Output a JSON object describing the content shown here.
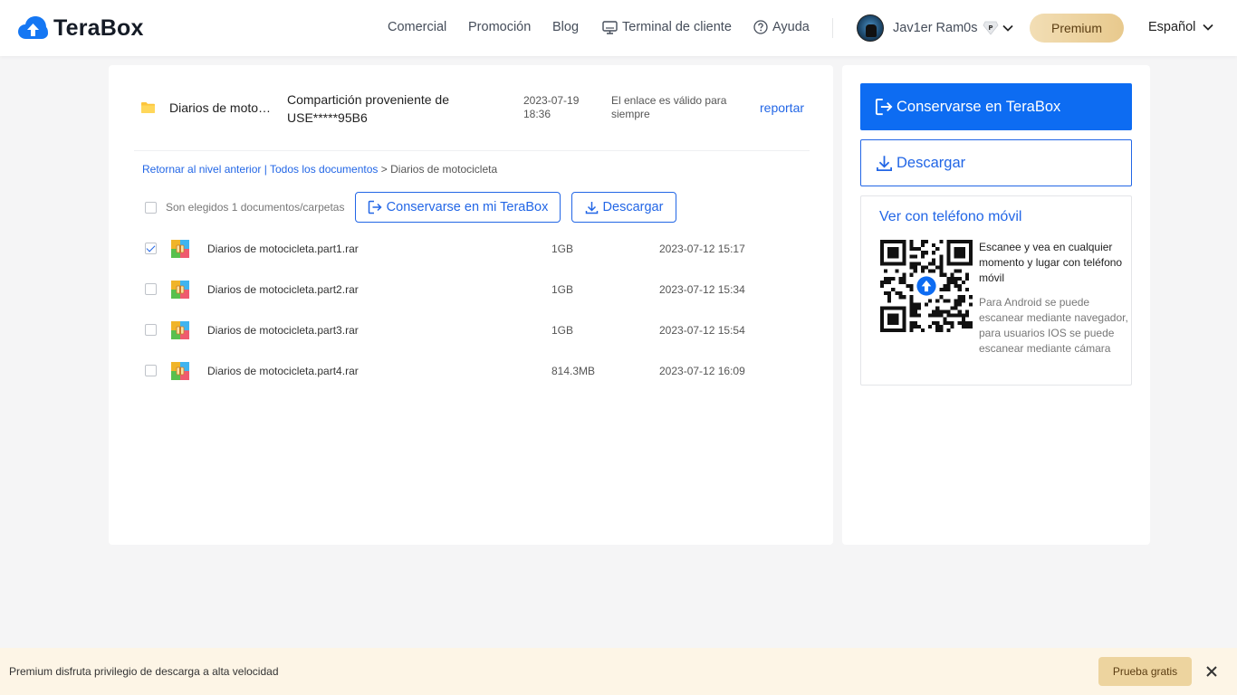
{
  "header": {
    "brand": "TeraBox",
    "nav": [
      "Comercial",
      "Promoción",
      "Blog",
      "Terminal de cliente",
      "Ayuda"
    ],
    "user_name": "Jav1er Ram0s",
    "premium_label": "Premium",
    "language": "Español"
  },
  "share": {
    "folder_name": "Diarios de motocicleta",
    "from_label": "Compartición proveniente de USE*****95B6",
    "date": "2023-07-19 18:36",
    "validity": "El enlace es válido para siempre",
    "report_label": "reportar"
  },
  "breadcrumb": {
    "back": "Retornar al nivel anterior",
    "sep": "|",
    "all": "Todos los documentos",
    "arrow": ">",
    "current": "Diarios de motocicleta"
  },
  "toolbar": {
    "selected_text": "Son elegidos 1 documentos/carpetas",
    "save_label": "Conservarse en mi TeraBox",
    "download_label": "Descargar"
  },
  "files": [
    {
      "name": "Diarios de motocicleta.part1.rar",
      "size": "1GB",
      "date": "2023-07-12 15:17",
      "checked": true
    },
    {
      "name": "Diarios de motocicleta.part2.rar",
      "size": "1GB",
      "date": "2023-07-12 15:34",
      "checked": false
    },
    {
      "name": "Diarios de motocicleta.part3.rar",
      "size": "1GB",
      "date": "2023-07-12 15:54",
      "checked": false
    },
    {
      "name": "Diarios de motocicleta.part4.rar",
      "size": "814.3MB",
      "date": "2023-07-12 16:09",
      "checked": false
    }
  ],
  "side": {
    "save_label": "Conservarse en TeraBox",
    "download_label": "Descargar",
    "mobile_title": "Ver con teléfono móvil",
    "scan_text": "Escanee y vea en cualquier momento y lugar con teléfono móvil",
    "android_text": "Para Android se puede escanear mediante navegador, para usuarios IOS se puede escanear mediante cámara"
  },
  "bottom": {
    "promo_text": "Premium disfruta privilegio de descarga a alta velocidad",
    "trial_label": "Prueba gratis"
  },
  "colors": {
    "accent": "#0d6cf2",
    "link": "#2266e6",
    "premium_gold": "#e8c98d",
    "banner_bg": "#fdf5e6"
  }
}
